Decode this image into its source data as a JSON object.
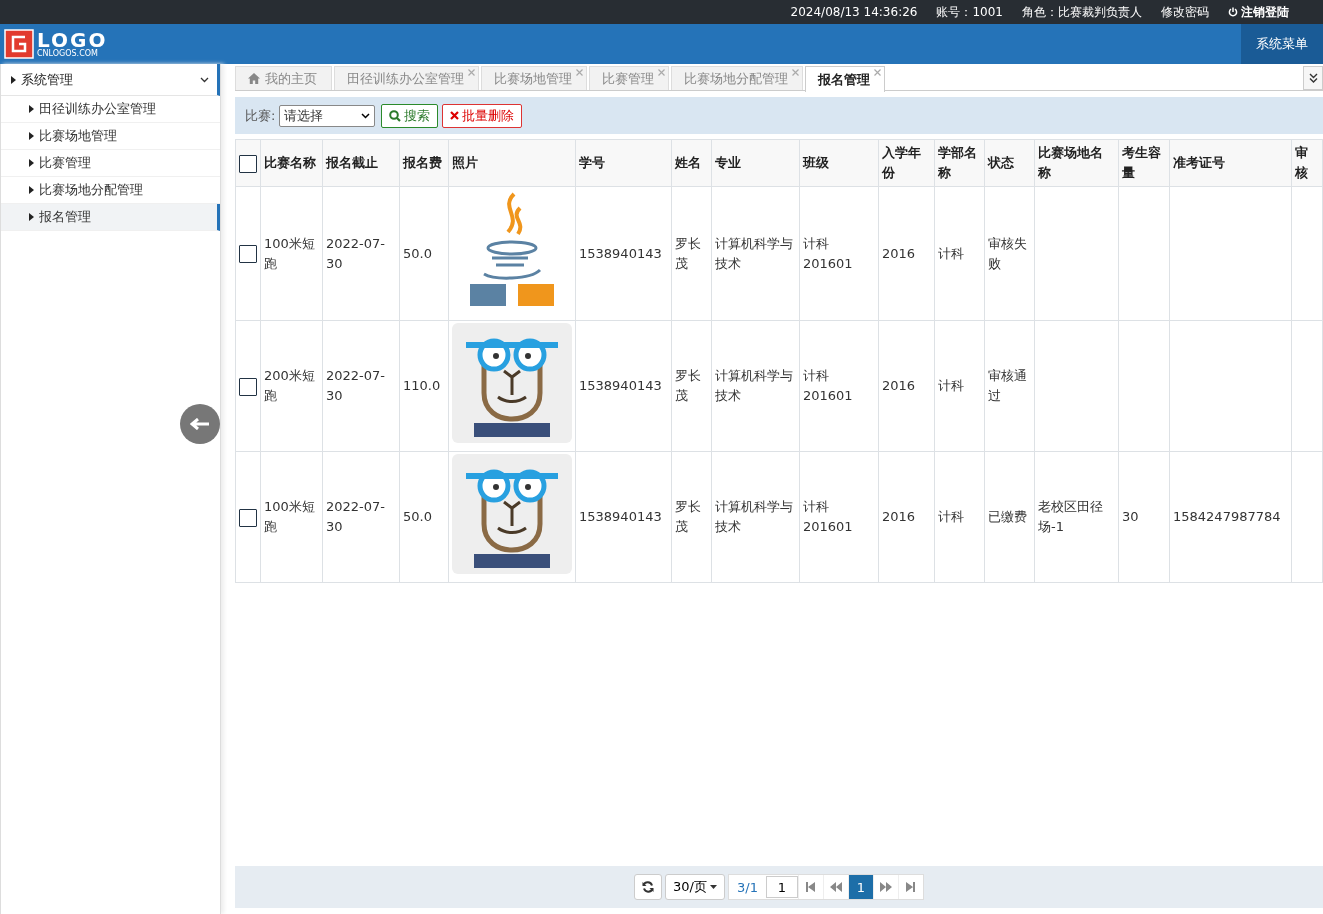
{
  "top_bar": {
    "datetime": "2024/08/13 14:36:26",
    "account": "账号：1001",
    "role": "角色：比赛裁判负责人",
    "change_password": "修改密码",
    "logout": "注销登陆"
  },
  "header": {
    "logo": {
      "title": "LOGO",
      "subtitle": "CNLOGOS.COM"
    },
    "menu_button": "系统菜单"
  },
  "sidebar": {
    "groups": [
      {
        "label": "系统管理",
        "expanded": true,
        "children": [
          {
            "label": "田径训练办公室管理",
            "selected": false
          },
          {
            "label": "比赛场地管理",
            "selected": false
          },
          {
            "label": "比赛管理",
            "selected": false
          },
          {
            "label": "比赛场地分配管理",
            "selected": false
          },
          {
            "label": "报名管理",
            "selected": true
          }
        ]
      }
    ]
  },
  "tabs": [
    {
      "label": "我的主页",
      "kind": "home",
      "selected": false
    },
    {
      "label": "田径训练办公室管理",
      "kind": "closable",
      "selected": false
    },
    {
      "label": "比赛场地管理",
      "kind": "closable",
      "selected": false
    },
    {
      "label": "比赛管理",
      "kind": "closable",
      "selected": false
    },
    {
      "label": "比赛场地分配管理",
      "kind": "closable",
      "selected": false
    },
    {
      "label": "报名管理",
      "kind": "closable",
      "selected": true
    }
  ],
  "toolbar": {
    "filter_label": "比赛:",
    "filter_value": "请选择",
    "search_button": "搜索",
    "batch_delete_button": "批量删除"
  },
  "table": {
    "select_all_checked": false,
    "columns": [
      "比赛名称",
      "报名截止",
      "报名费",
      "照片",
      "学号",
      "姓名",
      "专业",
      "班级",
      "入学年份",
      "学部名称",
      "状态",
      "比赛场地名称",
      "考生容量",
      "准考证号",
      "审核"
    ],
    "rows": [
      {
        "checked": false,
        "cells": [
          "100米短跑",
          "2022-07-30",
          "50.0",
          "",
          "1538940143",
          "罗长茂",
          "计算机科学与技术",
          "计科201601",
          "2016",
          "计科",
          "审核失败",
          "",
          "",
          "",
          ""
        ],
        "photo": {
          "kind": "cup"
        }
      },
      {
        "checked": false,
        "cells": [
          "200米短跑",
          "2022-07-30",
          "110.0",
          "",
          "1538940143",
          "罗长茂",
          "计算机科学与技术",
          "计科201601",
          "2016",
          "计科",
          "审核通过",
          "",
          "",
          "",
          ""
        ],
        "photo": {
          "kind": "monkey"
        }
      },
      {
        "checked": false,
        "cells": [
          "100米短跑",
          "2022-07-30",
          "50.0",
          "",
          "1538940143",
          "罗长茂",
          "计算机科学与技术",
          "计科201601",
          "2016",
          "计科",
          "已缴费",
          "老校区田径场-1",
          "30",
          "1584247987784",
          ""
        ],
        "photo": {
          "kind": "monkey"
        }
      }
    ]
  },
  "pagination": {
    "page_size": "30/页",
    "page_info": "3/1",
    "page_input": "1",
    "pages": [
      {
        "label": "1",
        "selected": true
      }
    ]
  }
}
